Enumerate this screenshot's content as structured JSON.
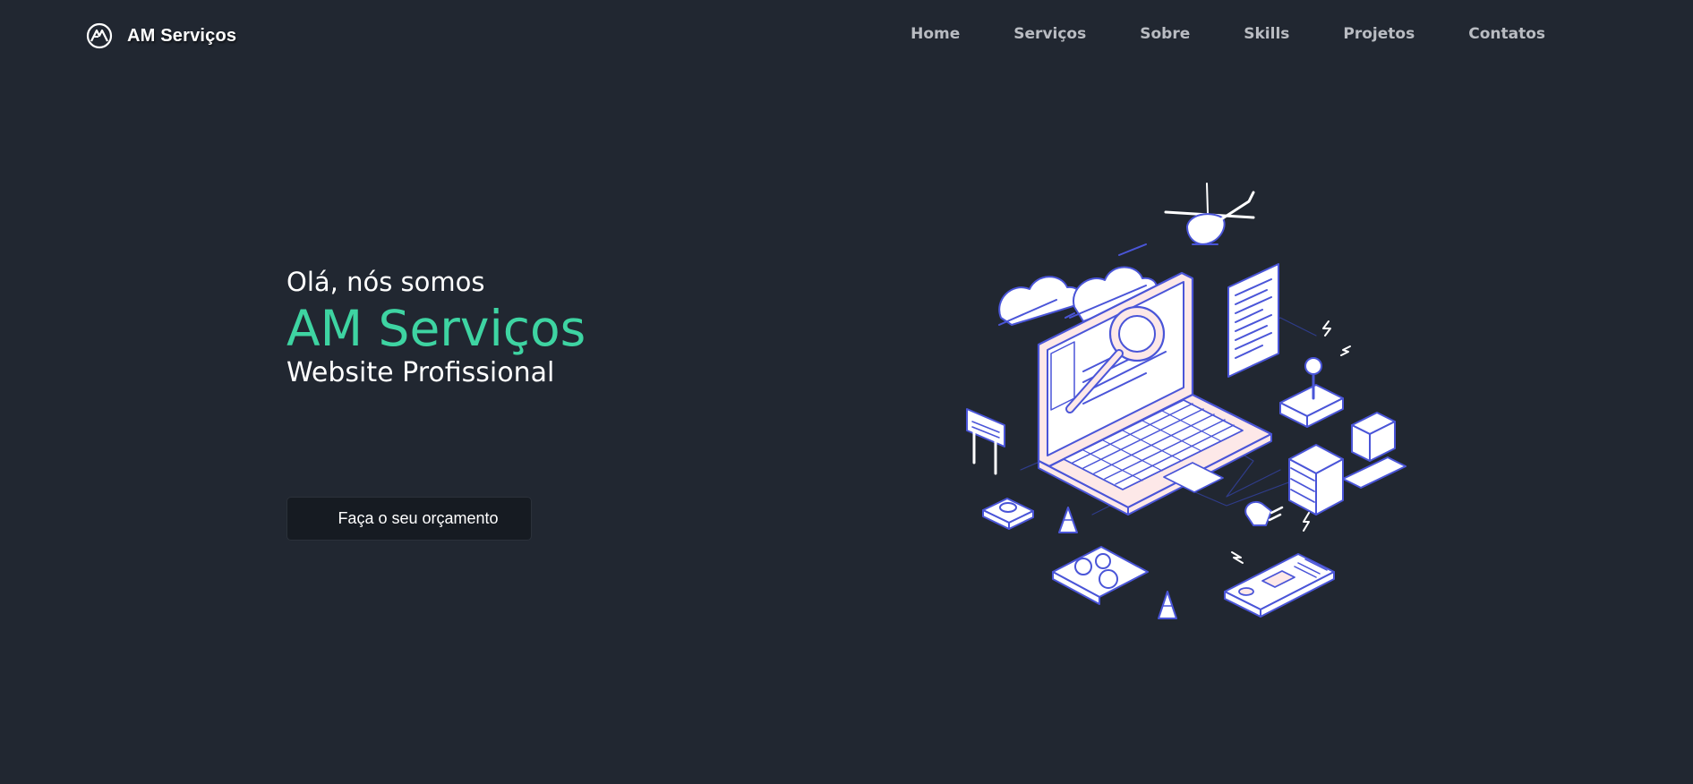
{
  "header": {
    "brand_name": "AM Serviços",
    "nav": [
      {
        "label": "Home"
      },
      {
        "label": "Serviços"
      },
      {
        "label": "Sobre"
      },
      {
        "label": "Skills"
      },
      {
        "label": "Projetos"
      },
      {
        "label": "Contatos"
      }
    ]
  },
  "hero": {
    "greeting": "Olá, nós somos",
    "company": "AM Serviços",
    "subtitle": "Website Profissional",
    "cta_label": "Faça o seu orçamento"
  },
  "colors": {
    "background": "#212731",
    "accent": "#3ed4a2",
    "button_bg": "#161b22",
    "nav_text": "#b9bcc2"
  },
  "icons": {
    "logo": "am-logo-icon",
    "illustration": "isometric-laptop-illustration"
  }
}
